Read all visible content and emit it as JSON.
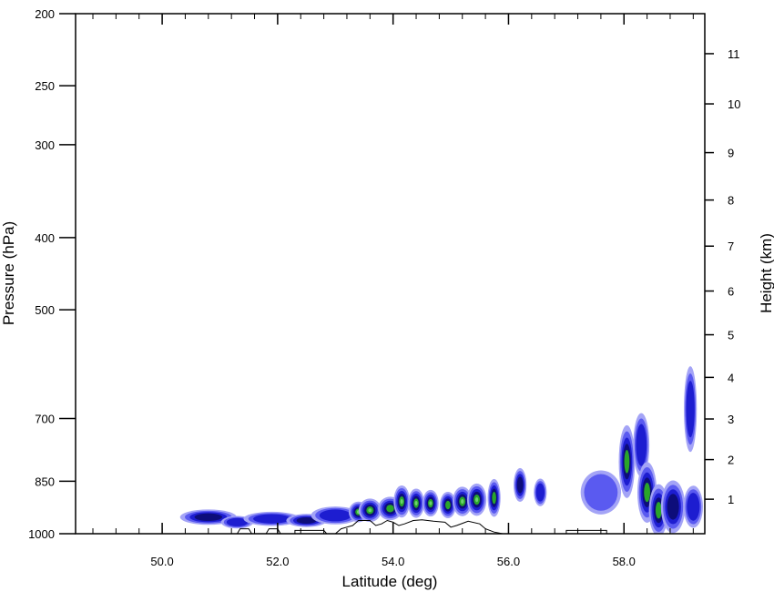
{
  "chart_data": {
    "type": "heatmap",
    "title": "",
    "xlabel": "Latitude (deg)",
    "ylabel_left": "Pressure (hPa)",
    "ylabel_right": "Height (km)",
    "xlim": [
      48.5,
      59.4
    ],
    "x_ticks": [
      50,
      52,
      54,
      56,
      58
    ],
    "x_tick_labels": [
      "50.0",
      "52.0",
      "54.0",
      "56.0",
      "58.0"
    ],
    "x_minor_step": 0.4,
    "y_scale": "log-pressure",
    "ylim_hpa": [
      1000,
      200
    ],
    "y_ticks_hpa": [
      200,
      250,
      300,
      400,
      500,
      700,
      850,
      1000
    ],
    "y_tick_labels": [
      "200",
      "250",
      "300",
      "400",
      "500",
      "700",
      "850",
      "1000"
    ],
    "height_ticks_km": [
      1,
      2,
      3,
      4,
      5,
      6,
      7,
      8,
      9,
      10,
      11
    ],
    "height_tick_labels": [
      "1",
      "2",
      "3",
      "4",
      "5",
      "6",
      "7",
      "8",
      "9",
      "10",
      "11"
    ],
    "grid": false,
    "levels_colors": [
      "#a4a4f6",
      "#5a5af0",
      "#1d1dd0",
      "#0d0d7a",
      "#2aa52a",
      "#6ed26e",
      "#d4e62e"
    ],
    "cells": [
      {
        "lat": 50.8,
        "p": 950,
        "level": 3,
        "w": 0.35,
        "h": 30
      },
      {
        "lat": 51.3,
        "p": 965,
        "level": 2,
        "w": 0.2,
        "h": 25
      },
      {
        "lat": 51.9,
        "p": 955,
        "level": 2,
        "w": 0.35,
        "h": 28
      },
      {
        "lat": 52.5,
        "p": 960,
        "level": 3,
        "w": 0.25,
        "h": 26
      },
      {
        "lat": 53.0,
        "p": 945,
        "level": 2,
        "w": 0.3,
        "h": 35
      },
      {
        "lat": 53.4,
        "p": 935,
        "level": 5,
        "w": 0.12,
        "h": 40
      },
      {
        "lat": 53.6,
        "p": 930,
        "level": 5,
        "w": 0.14,
        "h": 45
      },
      {
        "lat": 53.95,
        "p": 925,
        "level": 4,
        "w": 0.15,
        "h": 45
      },
      {
        "lat": 54.15,
        "p": 905,
        "level": 6,
        "w": 0.1,
        "h": 60
      },
      {
        "lat": 54.4,
        "p": 910,
        "level": 5,
        "w": 0.1,
        "h": 55
      },
      {
        "lat": 54.65,
        "p": 910,
        "level": 5,
        "w": 0.1,
        "h": 50
      },
      {
        "lat": 54.95,
        "p": 915,
        "level": 4,
        "w": 0.1,
        "h": 50
      },
      {
        "lat": 55.2,
        "p": 905,
        "level": 5,
        "w": 0.12,
        "h": 55
      },
      {
        "lat": 55.45,
        "p": 900,
        "level": 5,
        "w": 0.12,
        "h": 60
      },
      {
        "lat": 55.75,
        "p": 895,
        "level": 4,
        "w": 0.08,
        "h": 70
      },
      {
        "lat": 56.2,
        "p": 860,
        "level": 3,
        "w": 0.08,
        "h": 60
      },
      {
        "lat": 56.55,
        "p": 880,
        "level": 2,
        "w": 0.08,
        "h": 50
      },
      {
        "lat": 57.6,
        "p": 880,
        "level": 1,
        "w": 0.25,
        "h": 80
      },
      {
        "lat": 58.05,
        "p": 800,
        "level": 4,
        "w": 0.1,
        "h": 120
      },
      {
        "lat": 58.3,
        "p": 760,
        "level": 2,
        "w": 0.1,
        "h": 100
      },
      {
        "lat": 58.4,
        "p": 880,
        "level": 4,
        "w": 0.12,
        "h": 110
      },
      {
        "lat": 58.6,
        "p": 930,
        "level": 4,
        "w": 0.12,
        "h": 100
      },
      {
        "lat": 58.85,
        "p": 920,
        "level": 3,
        "w": 0.15,
        "h": 100
      },
      {
        "lat": 59.15,
        "p": 680,
        "level": 2,
        "w": 0.08,
        "h": 120
      },
      {
        "lat": 59.2,
        "p": 920,
        "level": 2,
        "w": 0.12,
        "h": 80
      }
    ],
    "terrain_outline": [
      [
        50.9,
        1000
      ],
      [
        51.3,
        1000
      ],
      [
        51.35,
        985
      ],
      [
        51.5,
        985
      ],
      [
        51.55,
        1000
      ],
      [
        51.8,
        1000
      ],
      [
        51.85,
        985
      ],
      [
        52.0,
        985
      ],
      [
        52.05,
        1000
      ],
      [
        52.3,
        1000
      ],
      [
        52.3,
        990
      ],
      [
        52.8,
        990
      ],
      [
        52.85,
        1000
      ],
      [
        53.0,
        1000
      ],
      [
        53.1,
        985
      ],
      [
        53.3,
        975
      ],
      [
        53.4,
        960
      ],
      [
        53.6,
        960
      ],
      [
        53.7,
        975
      ],
      [
        53.8,
        970
      ],
      [
        53.9,
        960
      ],
      [
        54.0,
        965
      ],
      [
        54.1,
        975
      ],
      [
        54.2,
        970
      ],
      [
        54.35,
        960
      ],
      [
        54.5,
        958
      ],
      [
        54.7,
        962
      ],
      [
        54.9,
        965
      ],
      [
        55.0,
        980
      ],
      [
        55.1,
        975
      ],
      [
        55.3,
        962
      ],
      [
        55.5,
        970
      ],
      [
        55.6,
        985
      ],
      [
        55.75,
        995
      ],
      [
        55.9,
        1000
      ],
      [
        57.0,
        1000
      ],
      [
        57.0,
        990
      ],
      [
        57.7,
        990
      ],
      [
        57.7,
        1000
      ]
    ]
  }
}
